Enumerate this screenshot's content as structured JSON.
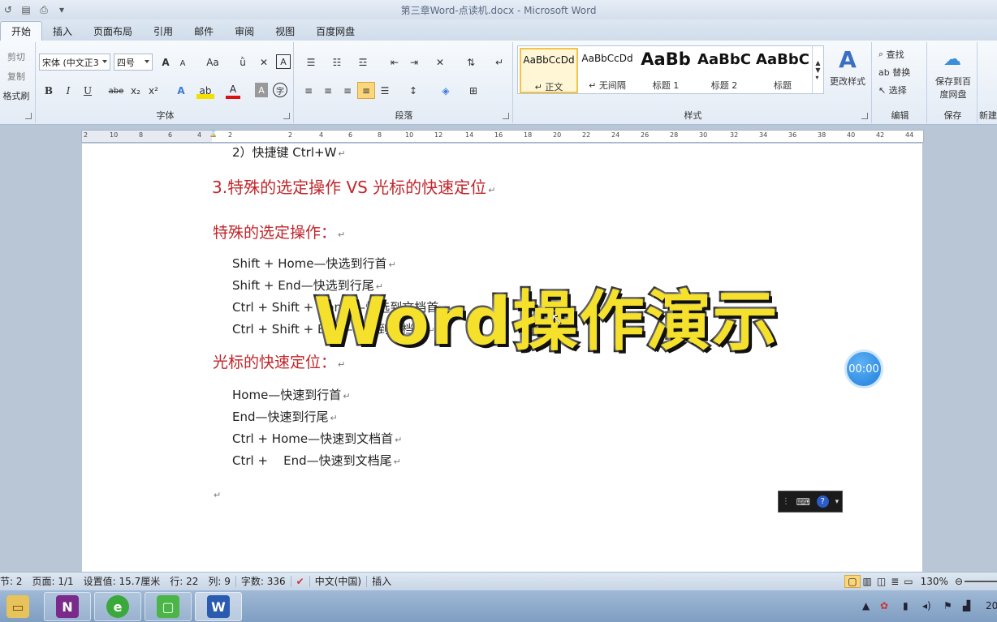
{
  "window": {
    "title": "第三章Word-点读机.docx - Microsoft Word"
  },
  "tabs": [
    "开始",
    "插入",
    "页面布局",
    "引用",
    "邮件",
    "审阅",
    "视图",
    "百度网盘"
  ],
  "ribbon": {
    "clipboard": {
      "cut": "剪切",
      "copy": "复制",
      "format_painter": "格式刷"
    },
    "font": {
      "label": "字体",
      "font_name": "宋体 (中文正3",
      "font_size": "四号",
      "bold": "B",
      "italic": "I",
      "underline": "U",
      "strike": "abe",
      "subscript": "x₂",
      "superscript": "x²",
      "aa": "Aa",
      "grow": "A",
      "shrink": "A"
    },
    "paragraph": {
      "label": "段落"
    },
    "styles": {
      "label": "样式",
      "items": [
        {
          "sample": "AaBbCcDd",
          "name": "↵ 正文"
        },
        {
          "sample": "AaBbCcDd",
          "name": "↵ 无间隔"
        },
        {
          "sample": "AaBb",
          "name": "标题 1"
        },
        {
          "sample": "AaBbC",
          "name": "标题 2"
        },
        {
          "sample": "AaBbC",
          "name": "标题"
        }
      ],
      "change_styles": "更改样式"
    },
    "editing": {
      "label": "编辑",
      "find": "查找",
      "replace": "替换",
      "select": "选择"
    },
    "save": {
      "label": "保存",
      "button": "保存到百度网盘",
      "line1": "保存到百",
      "line2": "度网盘"
    },
    "new_group": "新建"
  },
  "ruler": {
    "labels": [
      "2",
      "10",
      "8",
      "6",
      "4",
      "2",
      "2",
      "4",
      "6",
      "8",
      "10",
      "12",
      "14",
      "16",
      "18",
      "20",
      "22",
      "24",
      "26",
      "28",
      "30",
      "32",
      "34",
      "36",
      "38",
      "40",
      "42",
      "44"
    ]
  },
  "document": {
    "line_prev": "2）快捷键 Ctrl+W",
    "heading3": "3.特殊的选定操作 VS 光标的快速定位",
    "sub1": "特殊的选定操作：",
    "sel_items": [
      "Shift + Home—快选到行首",
      "Shift + End—快选到行尾",
      "Ctrl + Shift + Home—快选到文档首",
      "Ctrl + Shift + End—快选到文档尾"
    ],
    "sub2": "光标的快速定位：",
    "nav_items": [
      "Home—快速到行首",
      "End—快速到行尾",
      "Ctrl + Home—快速到文档首",
      "Ctrl +    End—快速到文档尾"
    ],
    "para_mark": "↵"
  },
  "overlay": {
    "text": "Word操作演示"
  },
  "timer": {
    "value": "00:00"
  },
  "statusbar": {
    "section": "节: 2",
    "page": "页面: 1/1",
    "position": "设置值: 15.7厘米",
    "line": "行: 22",
    "column": "列: 9",
    "words": "字数: 336",
    "language": "中文(中国)",
    "mode": "插入",
    "zoom": "130%"
  },
  "taskbar": {
    "clock": "20"
  }
}
